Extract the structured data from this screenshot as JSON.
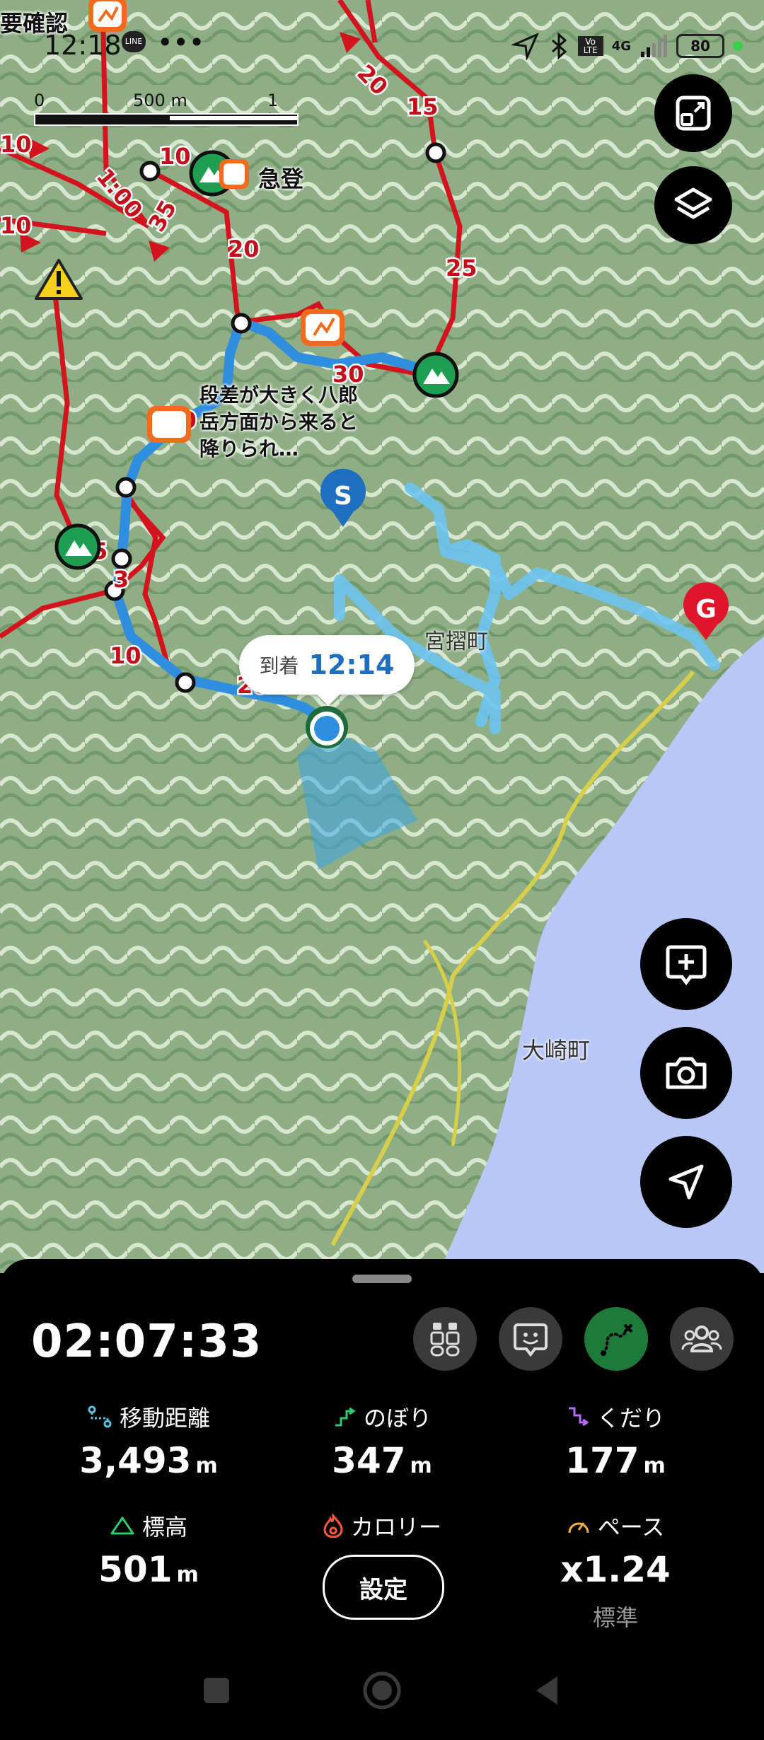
{
  "status_bar": {
    "time": "12:18",
    "more": "•••",
    "notification_app": "LINE",
    "network": "4G",
    "volte": "Vo LTE",
    "battery": "80",
    "status_dot_color": "#3ad14a",
    "icons": [
      "navigation-arrow-icon",
      "bluetooth-icon",
      "volte-icon",
      "signal-icon",
      "battery-icon"
    ]
  },
  "map": {
    "scale": {
      "zero": "0",
      "mid": "500 m",
      "end": "1 km"
    },
    "labels": {
      "need_check": "要確認",
      "steep": "急登",
      "warning_note": "段差が大きく八郎岳方面から来ると降りられ…",
      "town_1": "宮摺町",
      "town_2": "大崎町"
    },
    "arrival": {
      "label": "到着",
      "time": "12:14"
    },
    "markers": {
      "start": "S",
      "goal": "G"
    },
    "course_times": [
      "20",
      "15",
      "25",
      "30",
      "10",
      "35",
      "10",
      "10",
      "20",
      "-20",
      "5",
      "3",
      "10",
      "20",
      "1:00"
    ],
    "colors": {
      "route": "#d3141e",
      "track": "#2f8ee0",
      "planned": "#6cc4f0",
      "sea": "#b9c7f7"
    }
  },
  "fabs": {
    "top": [
      "fullscreen-icon",
      "layers-icon"
    ],
    "bottom": [
      "add-memo-icon",
      "camera-icon",
      "navigate-icon"
    ]
  },
  "panel": {
    "elapsed": "02:07:33",
    "tools": [
      "trekking-poles-icon",
      "memo-chat-icon",
      "route-icon",
      "group-icon"
    ],
    "stats": {
      "distance": {
        "label": "移動距離",
        "value": "3,493",
        "unit": "m"
      },
      "ascent": {
        "label": "のぼり",
        "value": "347",
        "unit": "m"
      },
      "descent": {
        "label": "くだり",
        "value": "177",
        "unit": "m"
      },
      "elevation": {
        "label": "標高",
        "value": "501",
        "unit": "m"
      },
      "calorie": {
        "label": "カロリー",
        "button": "設定"
      },
      "pace": {
        "label": "ペース",
        "value": "x1.24",
        "sub": "標準"
      }
    }
  },
  "navbar": [
    "recents-button",
    "home-button",
    "back-button"
  ]
}
